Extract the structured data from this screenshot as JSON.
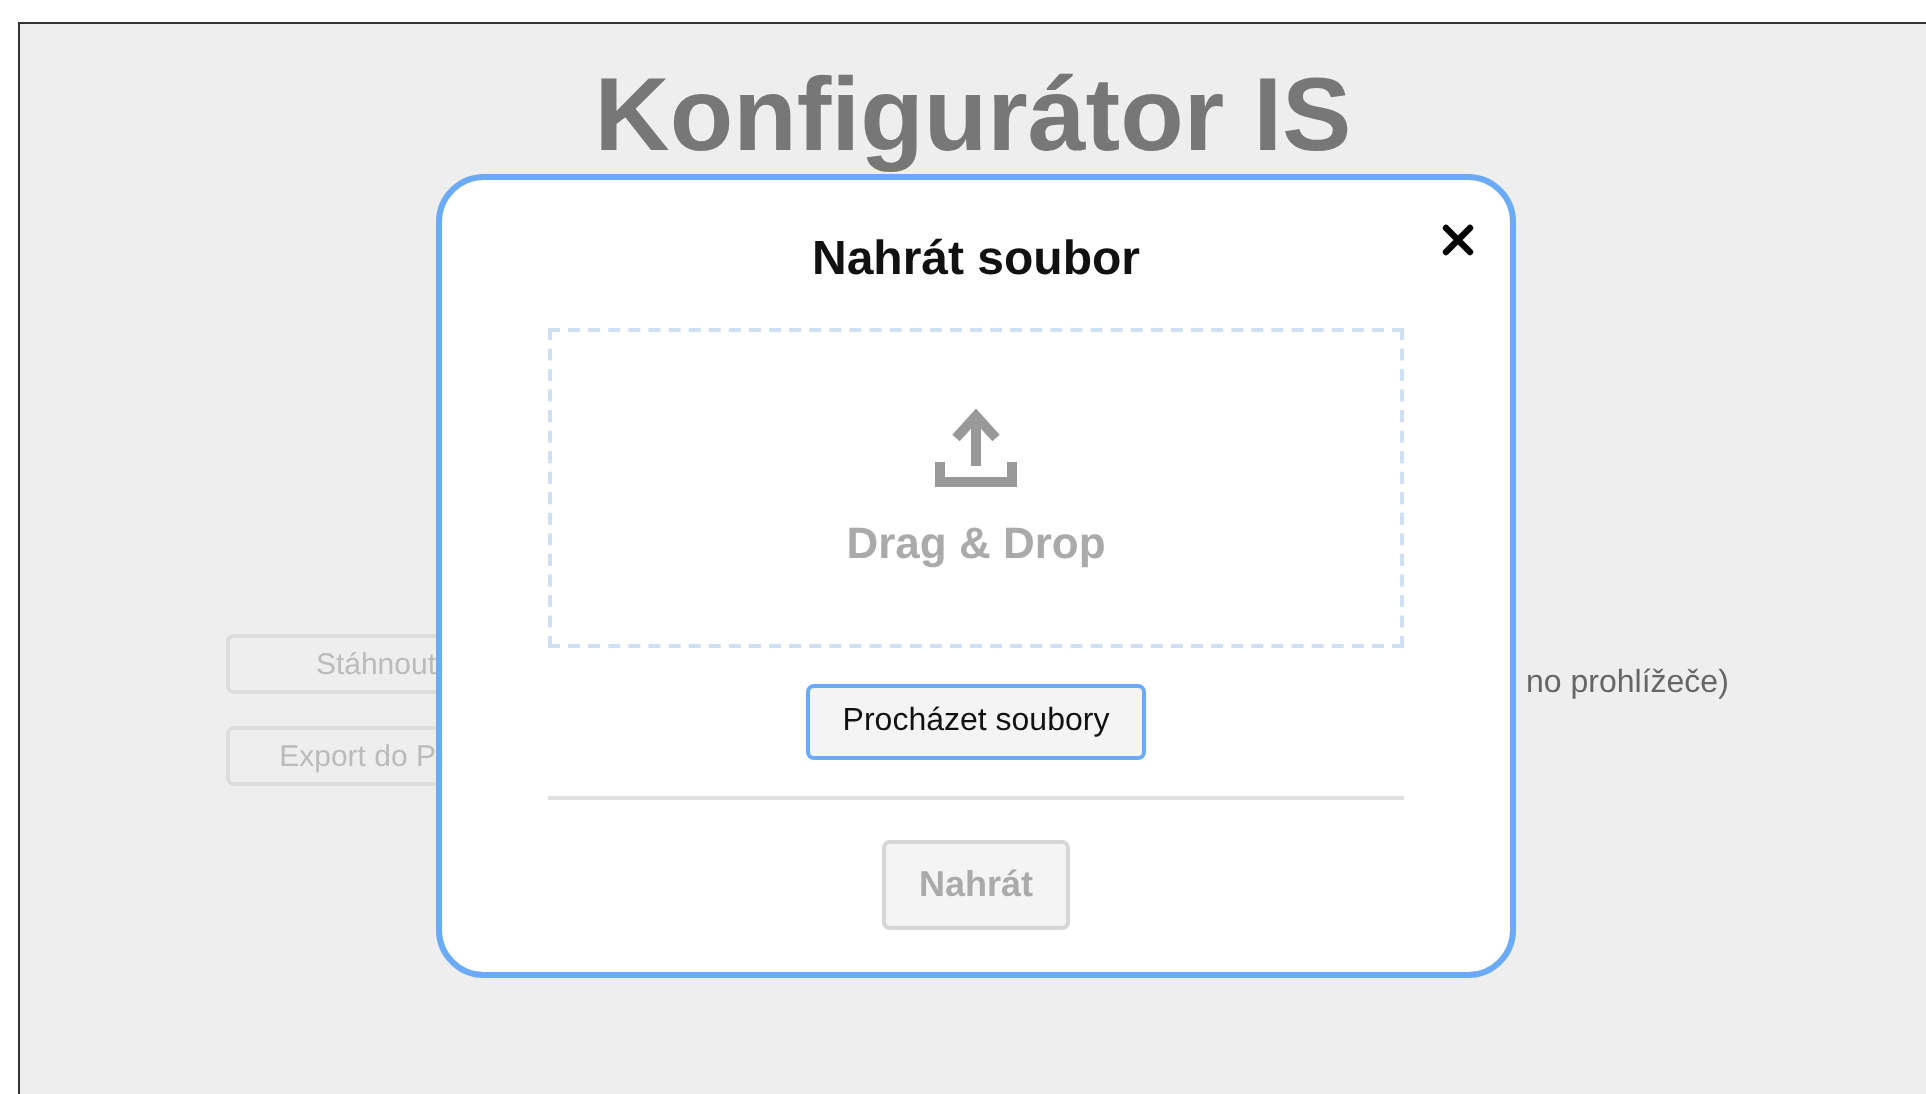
{
  "page": {
    "title": "Konfigurátor IS",
    "buttons": [
      {
        "label": "Stáhnout"
      },
      {
        "label": "Export do P"
      }
    ],
    "note": "no prohlížeče)"
  },
  "dialog": {
    "title": "Nahrát soubor",
    "dropzone": {
      "label": "Drag & Drop"
    },
    "browse_button": "Procházet soubory",
    "upload_button": {
      "label": "Nahrát",
      "disabled": true
    }
  }
}
